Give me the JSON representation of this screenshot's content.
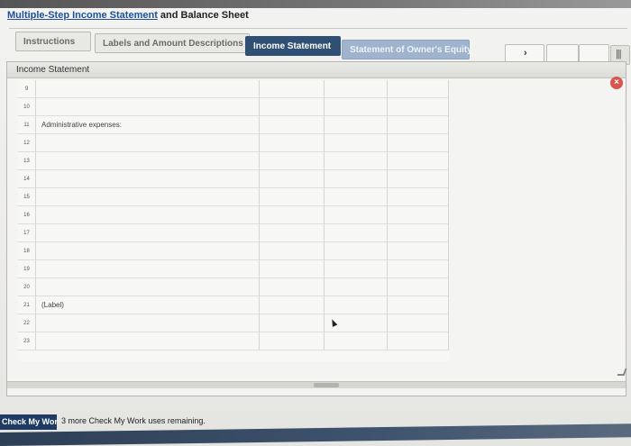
{
  "header": {
    "title_link": "Multiple-Step Income Statement",
    "title_rest": " and Balance Sheet"
  },
  "tabs": [
    {
      "label": "Instructions"
    },
    {
      "label": "Labels and Amount Descriptions"
    },
    {
      "label": "Income Statement"
    },
    {
      "label": "Statement of Owner's Equity"
    }
  ],
  "controls": {
    "dropdown_glyph": "›",
    "grid_glyph": "|||"
  },
  "panel": {
    "title": "Income Statement",
    "close_glyph": "×"
  },
  "rows": [
    {
      "num": "9",
      "label": ""
    },
    {
      "num": "10",
      "label": ""
    },
    {
      "num": "11",
      "label": "Administrative expenses:"
    },
    {
      "num": "12",
      "label": ""
    },
    {
      "num": "13",
      "label": ""
    },
    {
      "num": "14",
      "label": ""
    },
    {
      "num": "15",
      "label": ""
    },
    {
      "num": "16",
      "label": ""
    },
    {
      "num": "17",
      "label": ""
    },
    {
      "num": "18",
      "label": ""
    },
    {
      "num": "19",
      "label": ""
    },
    {
      "num": "20",
      "label": ""
    },
    {
      "num": "21",
      "label": "(Label)"
    },
    {
      "num": "22",
      "label": ""
    },
    {
      "num": "23",
      "label": ""
    }
  ],
  "footer": {
    "check_button": "Check My Work",
    "remaining_text": "3 more Check My Work uses remaining."
  },
  "colors": {
    "active_tab": "#2f4f73",
    "link": "#1f4f9c",
    "close": "#d9534f"
  }
}
